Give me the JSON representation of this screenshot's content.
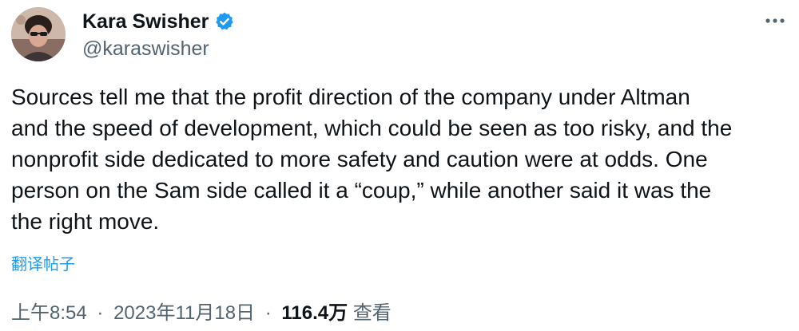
{
  "author": {
    "name": "Kara Swisher",
    "handle": "@karaswisher",
    "verified": true
  },
  "tweet": {
    "lines": [
      "Sources tell me that the profit direction of the company under Altman",
      "and the speed of development, which could be seen as too risky, and the",
      "nonprofit side dedicated to more safety and caution were at odds. One",
      "person on the Sam side called it a “coup,” while another said it was the",
      "the right move."
    ],
    "translate_label": "翻译帖子"
  },
  "meta": {
    "time": "上午8:54",
    "separator": "·",
    "date": "2023年11月18日",
    "views_count": "116.4万",
    "views_label": "查看"
  },
  "icons": {
    "verified": "verified-badge-icon",
    "more": "more-options-icon"
  },
  "colors": {
    "text": "#0f1419",
    "secondary": "#536471",
    "accent": "#1d9bf0"
  }
}
